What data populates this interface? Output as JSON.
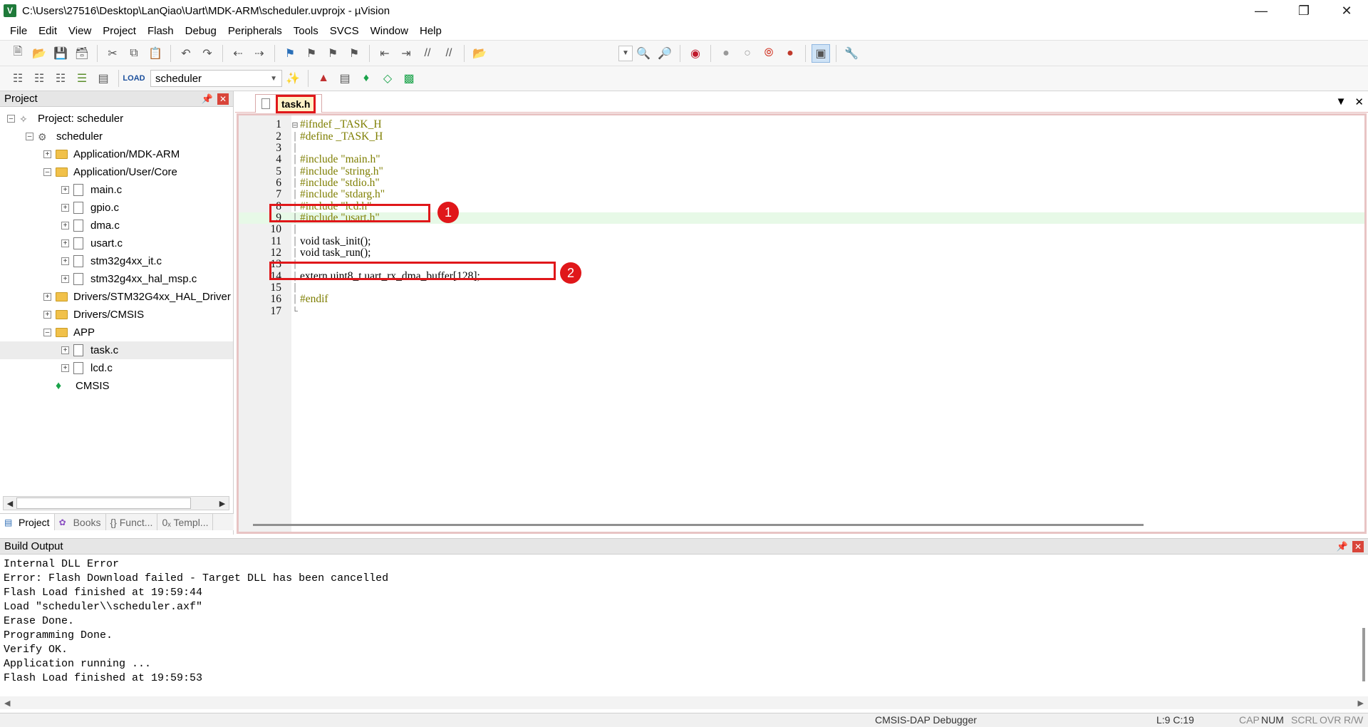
{
  "window": {
    "title": "C:\\Users\\27516\\Desktop\\LanQiao\\Uart\\MDK-ARM\\scheduler.uvprojx - µVision",
    "controls": [
      "minimize",
      "restore",
      "close"
    ]
  },
  "menu": [
    "File",
    "Edit",
    "View",
    "Project",
    "Flash",
    "Debug",
    "Peripherals",
    "Tools",
    "SVCS",
    "Window",
    "Help"
  ],
  "toolbar": {
    "target": "scheduler"
  },
  "project_panel": {
    "title": "Project",
    "tree": [
      {
        "label": "Project: scheduler",
        "level": 0
      },
      {
        "label": "scheduler",
        "level": 1
      },
      {
        "label": "Application/MDK-ARM",
        "level": 2
      },
      {
        "label": "Application/User/Core",
        "level": 2
      },
      {
        "label": "main.c",
        "level": 3
      },
      {
        "label": "gpio.c",
        "level": 3
      },
      {
        "label": "dma.c",
        "level": 3
      },
      {
        "label": "usart.c",
        "level": 3
      },
      {
        "label": "stm32g4xx_it.c",
        "level": 3
      },
      {
        "label": "stm32g4xx_hal_msp.c",
        "level": 3
      },
      {
        "label": "Drivers/STM32G4xx_HAL_Driver",
        "level": 2
      },
      {
        "label": "Drivers/CMSIS",
        "level": 2
      },
      {
        "label": "APP",
        "level": 2
      },
      {
        "label": "task.c",
        "level": 3
      },
      {
        "label": "lcd.c",
        "level": 3
      },
      {
        "label": "CMSIS",
        "level": 2
      }
    ],
    "tabs": [
      "Project",
      "Books",
      "{} Funct...",
      "0ₓ Templ..."
    ]
  },
  "editor": {
    "tab": "task.h",
    "lines": [
      {
        "n": "1",
        "text": "#ifndef _TASK_H"
      },
      {
        "n": "2",
        "text": "#define _TASK_H"
      },
      {
        "n": "3",
        "text": ""
      },
      {
        "n": "4",
        "text": "#include \"main.h\""
      },
      {
        "n": "5",
        "text": "#include \"string.h\""
      },
      {
        "n": "6",
        "text": "#include \"stdio.h\""
      },
      {
        "n": "7",
        "text": "#include \"stdarg.h\""
      },
      {
        "n": "8",
        "text": "#include \"lcd.h\""
      },
      {
        "n": "9",
        "text": "#include \"usart.h\""
      },
      {
        "n": "10",
        "text": ""
      },
      {
        "n": "11",
        "text": "void task_init();"
      },
      {
        "n": "12",
        "text": "void task_run();"
      },
      {
        "n": "13",
        "text": ""
      },
      {
        "n": "14",
        "text": "extern uint8_t uart_rx_dma_buffer[128];"
      },
      {
        "n": "15",
        "text": ""
      },
      {
        "n": "16",
        "text": "#endif"
      },
      {
        "n": "17",
        "text": ""
      }
    ],
    "callouts": [
      "1",
      "2"
    ]
  },
  "build_output": {
    "title": "Build Output",
    "lines": [
      "Internal DLL Error",
      "Error: Flash Download failed  -  Target DLL has been cancelled",
      "Flash Load finished at 19:59:44",
      "Load \"scheduler\\\\scheduler.axf\"",
      "Erase Done.",
      "Programming Done.",
      "Verify OK.",
      "Application running ...",
      "Flash Load finished at 19:59:53"
    ]
  },
  "status": {
    "debugger": "CMSIS-DAP Debugger",
    "position": "L:9 C:19",
    "cap": "CAP",
    "num": "NUM",
    "scrl": "SCRL",
    "ovr": "OVR",
    "rw": "R/W"
  }
}
